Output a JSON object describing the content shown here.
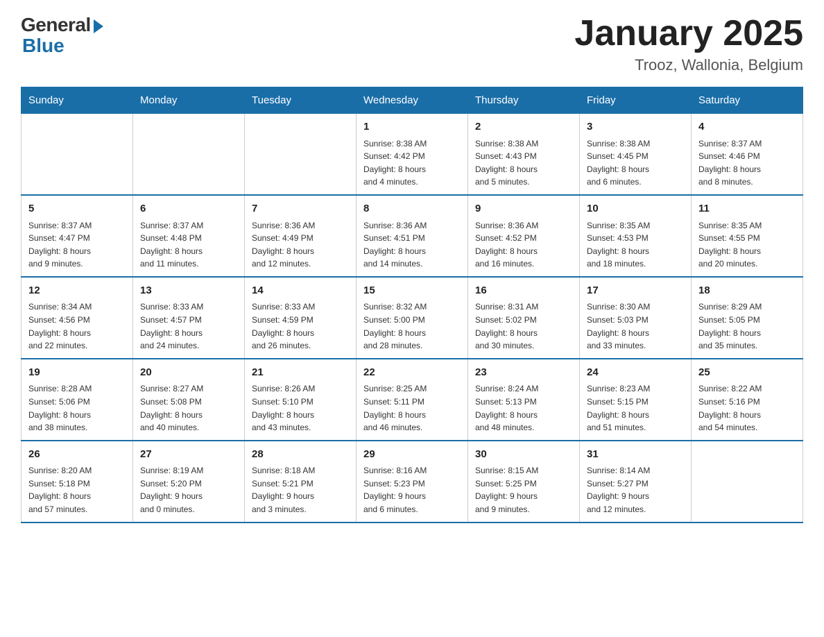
{
  "logo": {
    "general": "General",
    "blue": "Blue"
  },
  "title": "January 2025",
  "location": "Trooz, Wallonia, Belgium",
  "days_of_week": [
    "Sunday",
    "Monday",
    "Tuesday",
    "Wednesday",
    "Thursday",
    "Friday",
    "Saturday"
  ],
  "weeks": [
    [
      {
        "day": "",
        "info": ""
      },
      {
        "day": "",
        "info": ""
      },
      {
        "day": "",
        "info": ""
      },
      {
        "day": "1",
        "info": "Sunrise: 8:38 AM\nSunset: 4:42 PM\nDaylight: 8 hours\nand 4 minutes."
      },
      {
        "day": "2",
        "info": "Sunrise: 8:38 AM\nSunset: 4:43 PM\nDaylight: 8 hours\nand 5 minutes."
      },
      {
        "day": "3",
        "info": "Sunrise: 8:38 AM\nSunset: 4:45 PM\nDaylight: 8 hours\nand 6 minutes."
      },
      {
        "day": "4",
        "info": "Sunrise: 8:37 AM\nSunset: 4:46 PM\nDaylight: 8 hours\nand 8 minutes."
      }
    ],
    [
      {
        "day": "5",
        "info": "Sunrise: 8:37 AM\nSunset: 4:47 PM\nDaylight: 8 hours\nand 9 minutes."
      },
      {
        "day": "6",
        "info": "Sunrise: 8:37 AM\nSunset: 4:48 PM\nDaylight: 8 hours\nand 11 minutes."
      },
      {
        "day": "7",
        "info": "Sunrise: 8:36 AM\nSunset: 4:49 PM\nDaylight: 8 hours\nand 12 minutes."
      },
      {
        "day": "8",
        "info": "Sunrise: 8:36 AM\nSunset: 4:51 PM\nDaylight: 8 hours\nand 14 minutes."
      },
      {
        "day": "9",
        "info": "Sunrise: 8:36 AM\nSunset: 4:52 PM\nDaylight: 8 hours\nand 16 minutes."
      },
      {
        "day": "10",
        "info": "Sunrise: 8:35 AM\nSunset: 4:53 PM\nDaylight: 8 hours\nand 18 minutes."
      },
      {
        "day": "11",
        "info": "Sunrise: 8:35 AM\nSunset: 4:55 PM\nDaylight: 8 hours\nand 20 minutes."
      }
    ],
    [
      {
        "day": "12",
        "info": "Sunrise: 8:34 AM\nSunset: 4:56 PM\nDaylight: 8 hours\nand 22 minutes."
      },
      {
        "day": "13",
        "info": "Sunrise: 8:33 AM\nSunset: 4:57 PM\nDaylight: 8 hours\nand 24 minutes."
      },
      {
        "day": "14",
        "info": "Sunrise: 8:33 AM\nSunset: 4:59 PM\nDaylight: 8 hours\nand 26 minutes."
      },
      {
        "day": "15",
        "info": "Sunrise: 8:32 AM\nSunset: 5:00 PM\nDaylight: 8 hours\nand 28 minutes."
      },
      {
        "day": "16",
        "info": "Sunrise: 8:31 AM\nSunset: 5:02 PM\nDaylight: 8 hours\nand 30 minutes."
      },
      {
        "day": "17",
        "info": "Sunrise: 8:30 AM\nSunset: 5:03 PM\nDaylight: 8 hours\nand 33 minutes."
      },
      {
        "day": "18",
        "info": "Sunrise: 8:29 AM\nSunset: 5:05 PM\nDaylight: 8 hours\nand 35 minutes."
      }
    ],
    [
      {
        "day": "19",
        "info": "Sunrise: 8:28 AM\nSunset: 5:06 PM\nDaylight: 8 hours\nand 38 minutes."
      },
      {
        "day": "20",
        "info": "Sunrise: 8:27 AM\nSunset: 5:08 PM\nDaylight: 8 hours\nand 40 minutes."
      },
      {
        "day": "21",
        "info": "Sunrise: 8:26 AM\nSunset: 5:10 PM\nDaylight: 8 hours\nand 43 minutes."
      },
      {
        "day": "22",
        "info": "Sunrise: 8:25 AM\nSunset: 5:11 PM\nDaylight: 8 hours\nand 46 minutes."
      },
      {
        "day": "23",
        "info": "Sunrise: 8:24 AM\nSunset: 5:13 PM\nDaylight: 8 hours\nand 48 minutes."
      },
      {
        "day": "24",
        "info": "Sunrise: 8:23 AM\nSunset: 5:15 PM\nDaylight: 8 hours\nand 51 minutes."
      },
      {
        "day": "25",
        "info": "Sunrise: 8:22 AM\nSunset: 5:16 PM\nDaylight: 8 hours\nand 54 minutes."
      }
    ],
    [
      {
        "day": "26",
        "info": "Sunrise: 8:20 AM\nSunset: 5:18 PM\nDaylight: 8 hours\nand 57 minutes."
      },
      {
        "day": "27",
        "info": "Sunrise: 8:19 AM\nSunset: 5:20 PM\nDaylight: 9 hours\nand 0 minutes."
      },
      {
        "day": "28",
        "info": "Sunrise: 8:18 AM\nSunset: 5:21 PM\nDaylight: 9 hours\nand 3 minutes."
      },
      {
        "day": "29",
        "info": "Sunrise: 8:16 AM\nSunset: 5:23 PM\nDaylight: 9 hours\nand 6 minutes."
      },
      {
        "day": "30",
        "info": "Sunrise: 8:15 AM\nSunset: 5:25 PM\nDaylight: 9 hours\nand 9 minutes."
      },
      {
        "day": "31",
        "info": "Sunrise: 8:14 AM\nSunset: 5:27 PM\nDaylight: 9 hours\nand 12 minutes."
      },
      {
        "day": "",
        "info": ""
      }
    ]
  ]
}
